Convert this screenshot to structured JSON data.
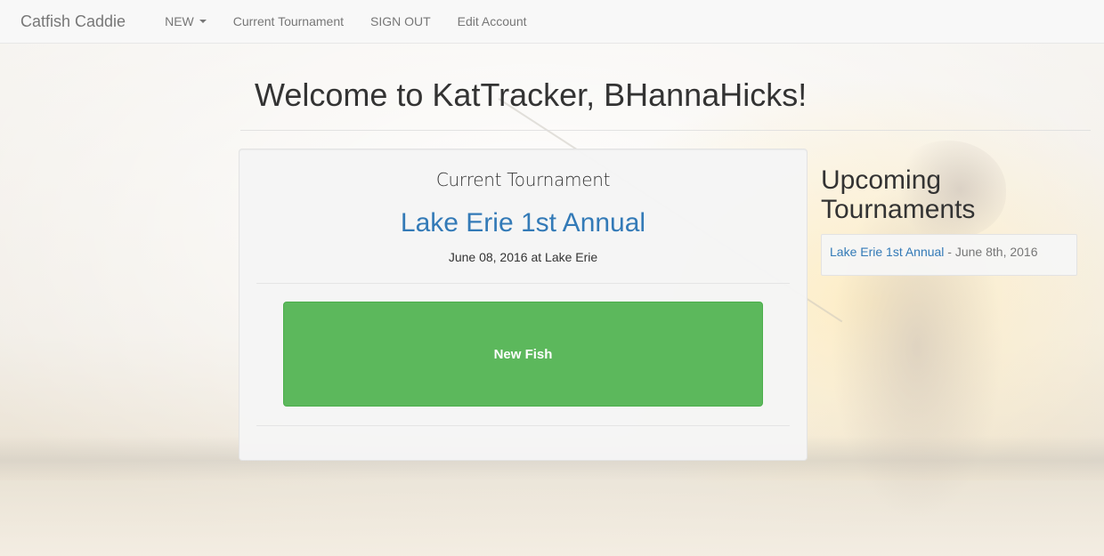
{
  "navbar": {
    "brand": "Catfish Caddie",
    "items": [
      {
        "label": "NEW",
        "has_caret": true
      },
      {
        "label": "Current Tournament"
      },
      {
        "label": "SIGN OUT"
      },
      {
        "label": "Edit Account"
      }
    ]
  },
  "page": {
    "title": "Welcome to KatTracker, BHannaHicks!"
  },
  "current_tournament": {
    "heading": "Current Tournament",
    "name": "Lake Erie 1st Annual",
    "info": "June 08, 2016 at Lake Erie",
    "new_fish_label": "New Fish"
  },
  "upcoming": {
    "heading": "Upcoming Tournaments",
    "items": [
      {
        "name": "Lake Erie 1st Annual",
        "date_text": " - June 8th, 2016"
      }
    ]
  },
  "colors": {
    "link": "#337ab7",
    "success": "#5cb85c",
    "navbar_bg": "#f8f8f8",
    "navbar_text": "#777777"
  },
  "icons": {
    "dropdown": "chevron-down-icon"
  }
}
